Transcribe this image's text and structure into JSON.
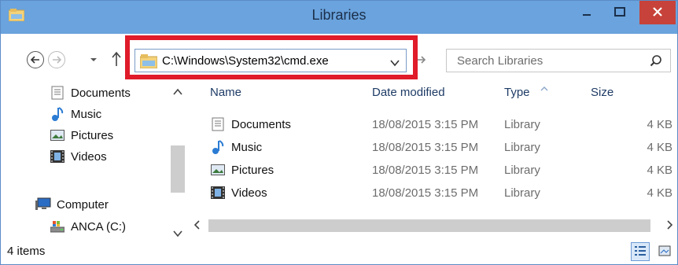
{
  "window": {
    "title": "Libraries"
  },
  "address": {
    "path": "C:\\Windows\\System32\\cmd.exe"
  },
  "search": {
    "placeholder": "Search Libraries"
  },
  "navpane": {
    "items": [
      {
        "label": "Documents",
        "icon": "documents-library-icon"
      },
      {
        "label": "Music",
        "icon": "music-library-icon"
      },
      {
        "label": "Pictures",
        "icon": "pictures-library-icon"
      },
      {
        "label": "Videos",
        "icon": "videos-library-icon"
      },
      {
        "label": "Computer",
        "icon": "computer-icon"
      },
      {
        "label": "ANCA (C:)",
        "icon": "drive-icon"
      }
    ]
  },
  "filelist": {
    "columns": [
      "Name",
      "Date modified",
      "Type",
      "Size"
    ],
    "rows": [
      {
        "name": "Documents",
        "date": "18/08/2015 3:15 PM",
        "type": "Library",
        "size": "4 KB"
      },
      {
        "name": "Music",
        "date": "18/08/2015 3:15 PM",
        "type": "Library",
        "size": "4 KB"
      },
      {
        "name": "Pictures",
        "date": "18/08/2015 3:15 PM",
        "type": "Library",
        "size": "4 KB"
      },
      {
        "name": "Videos",
        "date": "18/08/2015 3:15 PM",
        "type": "Library",
        "size": "4 KB"
      }
    ]
  },
  "status": {
    "items": "4 items"
  },
  "colors": {
    "titlebar": "#6aa3dd",
    "close": "#c7423a",
    "highlight": "#e01b2a"
  }
}
